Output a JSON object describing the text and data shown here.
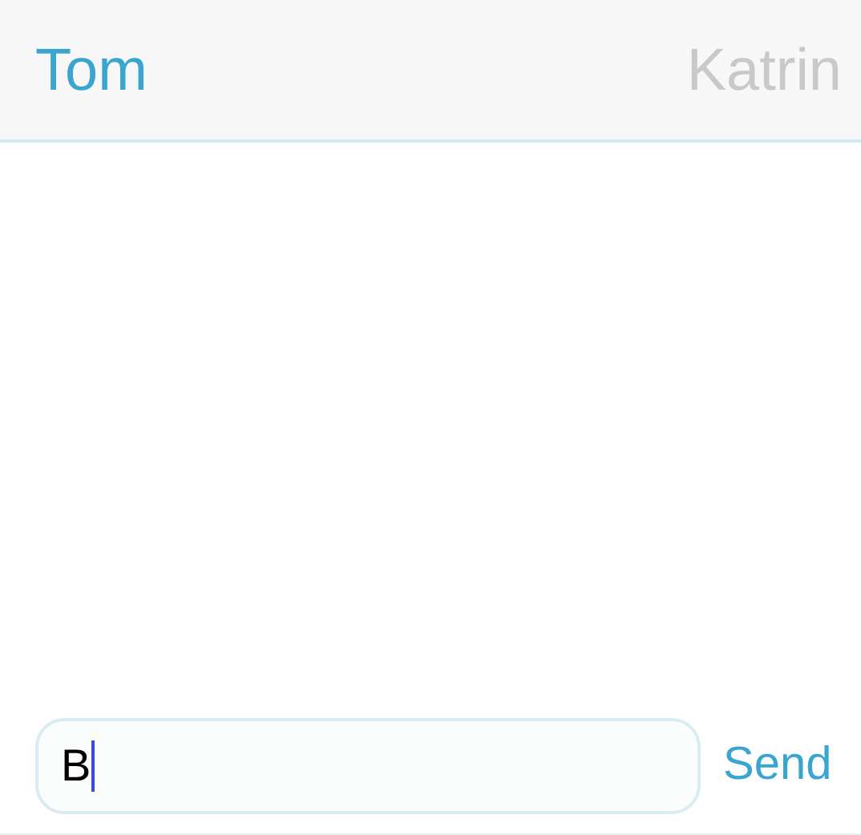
{
  "tabs": [
    {
      "label": "Tom",
      "selected": true
    },
    {
      "label": "Katrin",
      "selected": false
    }
  ],
  "composer": {
    "value": "B",
    "send": "Send"
  }
}
